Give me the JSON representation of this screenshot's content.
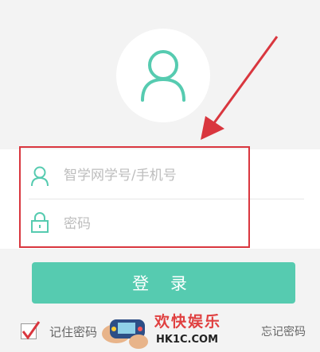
{
  "login_form": {
    "username_placeholder": "智学网学号/手机号",
    "password_placeholder": "密码"
  },
  "actions": {
    "login_label": "登 录",
    "remember_label": "记住密码",
    "remember_checked": true,
    "forgot_label": "忘记密码"
  },
  "icons": {
    "avatar": "user-avatar-icon",
    "username": "user-icon",
    "password": "lock-icon",
    "checkbox": "checkmark-icon"
  },
  "watermark": {
    "title": "欢快娱乐",
    "url": "HK1C.COM"
  },
  "colors": {
    "accent": "#56cbb0",
    "annotation": "#d9363e",
    "placeholder": "#bdbdbd"
  }
}
